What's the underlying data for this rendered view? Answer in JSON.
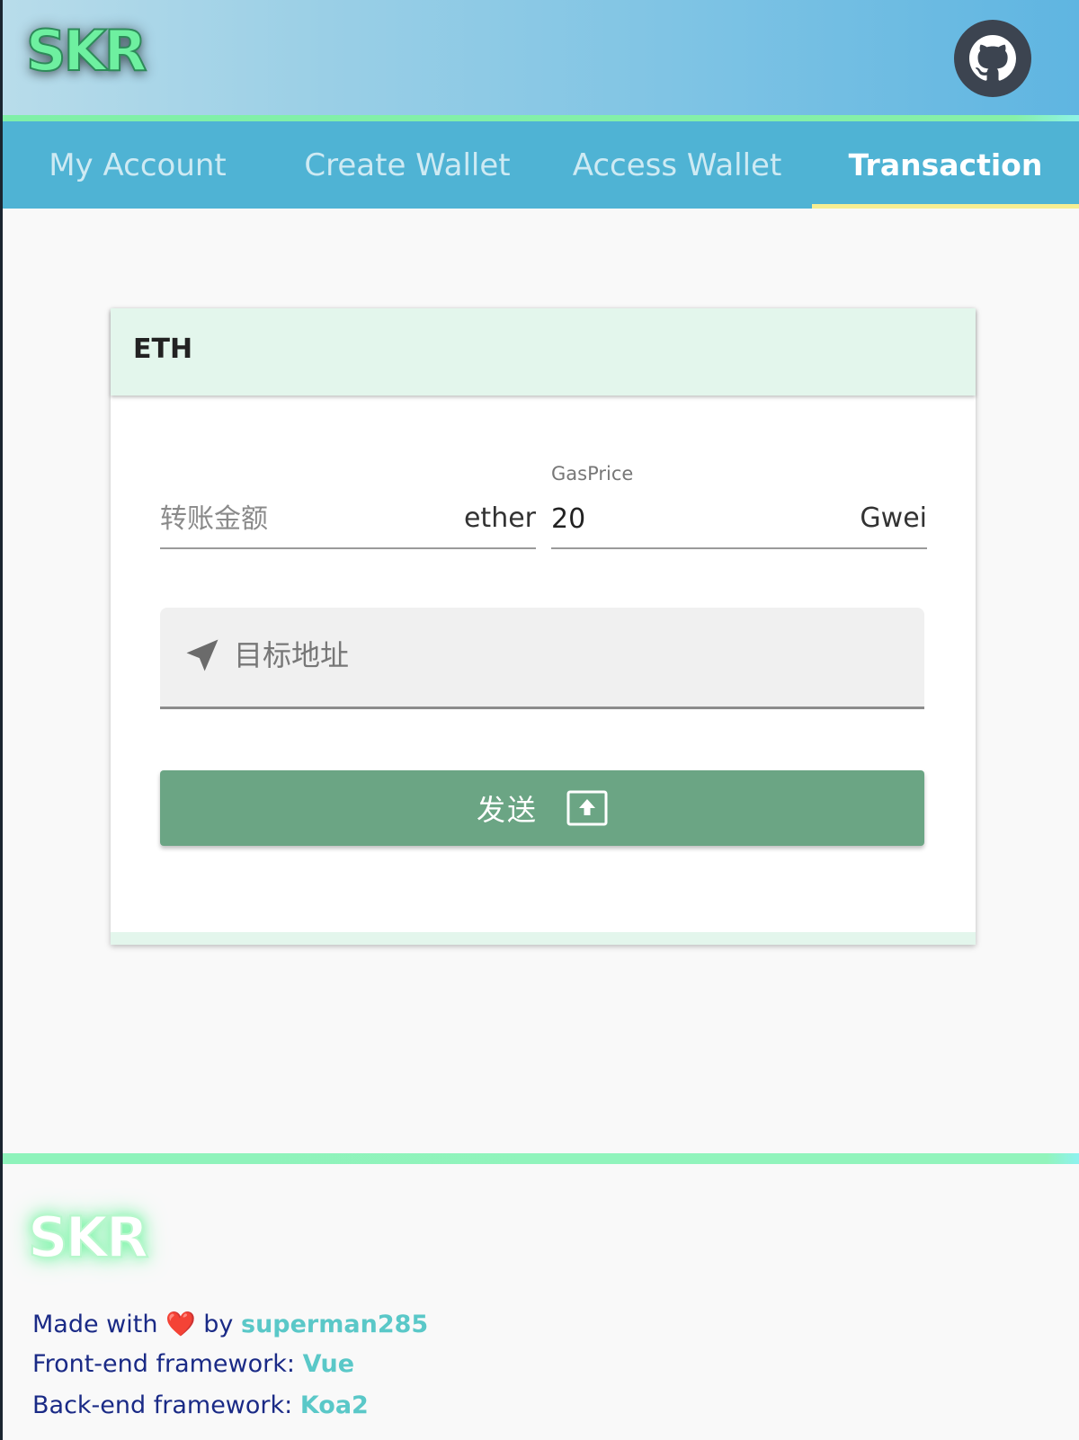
{
  "header": {
    "logo_text": "SKR",
    "github_icon": "github-icon"
  },
  "tabs": [
    {
      "label": "My Account",
      "active": false
    },
    {
      "label": "Create Wallet",
      "active": false
    },
    {
      "label": "Access Wallet",
      "active": false
    },
    {
      "label": "Transaction",
      "active": true
    }
  ],
  "card": {
    "title": "ETH",
    "amount": {
      "placeholder": "转账金额",
      "value": "",
      "suffix": "ether"
    },
    "gas": {
      "label": "GasPrice",
      "value": "20",
      "suffix": "Gwei"
    },
    "address": {
      "icon": "send-arrow-icon",
      "placeholder": "目标地址",
      "value": ""
    },
    "send_button": {
      "label": "发送",
      "icon": "upload-box-icon"
    }
  },
  "footer": {
    "logo_text": "SKR",
    "made_with": "Made with",
    "heart": "❤️",
    "by": "by",
    "author": "superman285",
    "frontend_label": "Front-end framework:",
    "frontend_value": "Vue",
    "backend_label": "Back-end framework:",
    "backend_value": "Koa2"
  },
  "colors": {
    "header_gradient_start": "#b8dcea",
    "header_gradient_end": "#5fb5e1",
    "tab_bar": "#4fb3d4",
    "accent_stripe": "#7ff0a8",
    "active_tab_underline": "#f6ee92",
    "card_header_bg": "#e3f6ec",
    "send_button": "#6ba584",
    "footer_text": "#1a2a86",
    "footer_link": "#5ac8c8"
  }
}
